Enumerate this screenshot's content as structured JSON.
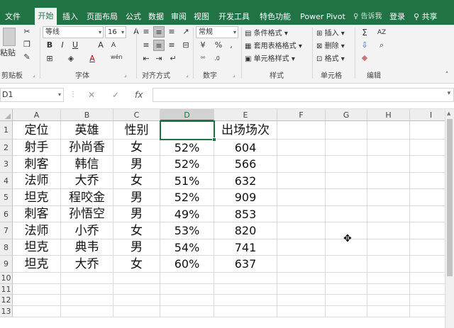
{
  "window": {
    "title_partial": ""
  },
  "tabs": [
    "文件",
    "开始",
    "插入",
    "页面布局",
    "公式",
    "数据",
    "审阅",
    "视图",
    "开发工具",
    "特色功能",
    "Power Pivot"
  ],
  "active_tab": "开始",
  "tell_me": "告诉我",
  "login": "登录",
  "share": "共享",
  "ribbon": {
    "clipboard": {
      "paste": "粘贴",
      "label": "剪贴板"
    },
    "font": {
      "name": "等线",
      "size": "16",
      "bold": "B",
      "italic": "I",
      "underline": "U",
      "grow": "A",
      "shrink": "A",
      "font_color": "A",
      "wen": "wén",
      "label": "字体"
    },
    "alignment": {
      "label": "对齐方式"
    },
    "number": {
      "format": "常规",
      "percent": "%",
      "comma": ",",
      "label": "数字"
    },
    "styles": {
      "conditional": "条件格式",
      "table": "套用表格格式",
      "cell": "单元格样式",
      "label": "样式"
    },
    "cells": {
      "insert": "插入",
      "delete": "删除",
      "format": "格式",
      "label": "单元格"
    },
    "editing": {
      "label": "编辑"
    }
  },
  "formula_bar": {
    "name_box": "D1",
    "fx": "fx",
    "value": ""
  },
  "columns": [
    "A",
    "B",
    "C",
    "D",
    "E",
    "F",
    "G",
    "H",
    "I"
  ],
  "selected_column": "D",
  "rows": [
    [
      "定位",
      "英雄",
      "性别",
      "",
      "出场场次"
    ],
    [
      "射手",
      "孙尚香",
      "女",
      "52%",
      "604"
    ],
    [
      "刺客",
      "韩信",
      "男",
      "52%",
      "566"
    ],
    [
      "法师",
      "大乔",
      "女",
      "51%",
      "632"
    ],
    [
      "坦克",
      "程咬金",
      "男",
      "52%",
      "909"
    ],
    [
      "刺客",
      "孙悟空",
      "男",
      "49%",
      "853"
    ],
    [
      "法师",
      "小乔",
      "女",
      "53%",
      "820"
    ],
    [
      "坦克",
      "典韦",
      "男",
      "54%",
      "741"
    ],
    [
      "坦克",
      "大乔",
      "女",
      "60%",
      "637"
    ],
    [
      "",
      "",
      "",
      "",
      ""
    ],
    [
      "",
      "",
      "",
      "",
      ""
    ],
    [
      "",
      "",
      "",
      "",
      ""
    ],
    [
      "",
      "",
      "",
      "",
      ""
    ]
  ],
  "row_numbers": [
    "1",
    "2",
    "3",
    "4",
    "5",
    "6",
    "7",
    "8",
    "9",
    "10",
    "11",
    "12",
    "13"
  ]
}
